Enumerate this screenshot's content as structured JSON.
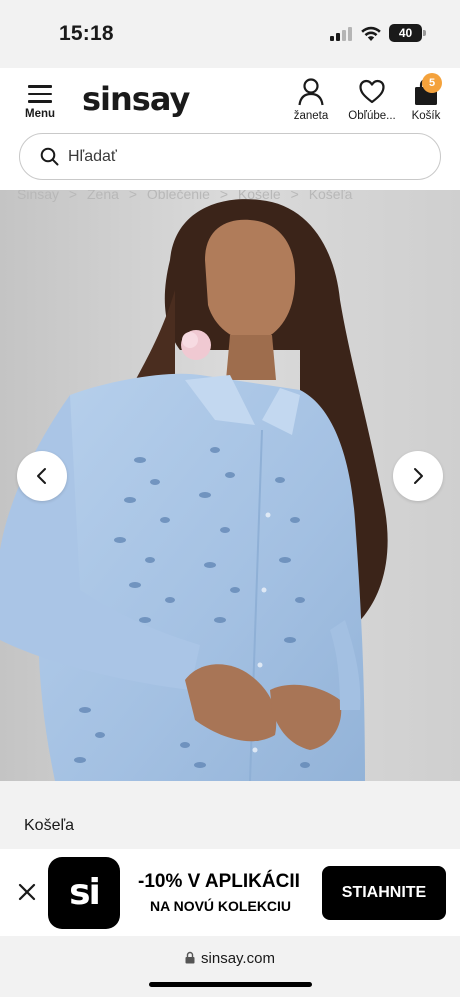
{
  "status_bar": {
    "time": "15:18",
    "battery": "40"
  },
  "header": {
    "menu_label": "Menu",
    "logo": "sinsay",
    "account_label": "žaneta",
    "favorites_label": "Obľúbe...",
    "cart_label": "Košík",
    "cart_count": "5",
    "search_placeholder": "Hľadať"
  },
  "breadcrumb": [
    "Sinsay",
    "Žena",
    "Oblečenie",
    "Košele",
    "Košeľa"
  ],
  "breadcrumb_separator": ">",
  "product": {
    "title": "Košeľa"
  },
  "promo": {
    "app_logo_text": "si",
    "headline": "-10% V APLIKÁCII",
    "subline": "NA NOVÚ KOLEKCIU",
    "button_label": "STIAHNITE"
  },
  "browser": {
    "url": "sinsay.com"
  },
  "colors": {
    "cart_badge": "#f4a23c",
    "shirt": "#a9c6e6",
    "page_bg": "#f2f2f2"
  }
}
